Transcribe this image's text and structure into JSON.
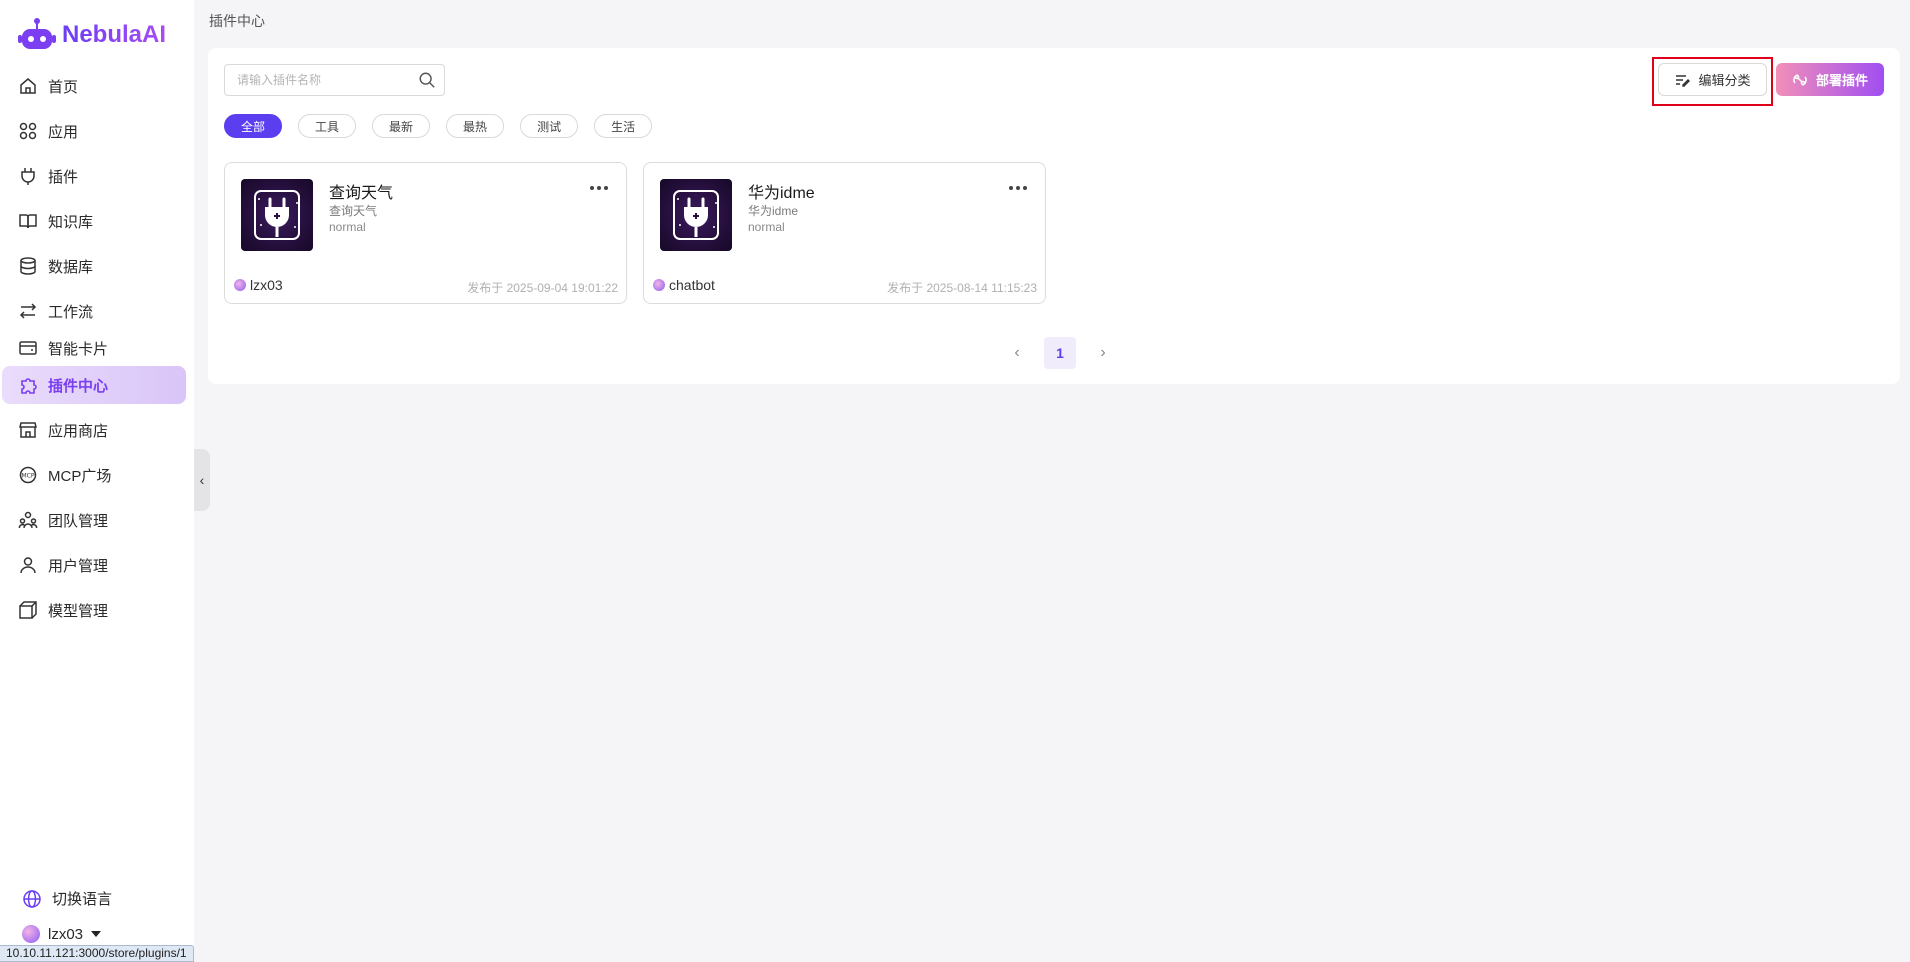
{
  "brand": {
    "name": "NebulaAI"
  },
  "sidebar": {
    "items": [
      {
        "label": "首页",
        "icon": "home-icon"
      },
      {
        "label": "应用",
        "icon": "apps-icon"
      },
      {
        "label": "插件",
        "icon": "plug-icon"
      },
      {
        "label": "知识库",
        "icon": "book-icon"
      },
      {
        "label": "数据库",
        "icon": "database-icon"
      },
      {
        "label": "工作流",
        "icon": "workflow-icon"
      },
      {
        "label": "智能卡片",
        "icon": "card-icon"
      },
      {
        "label": "插件中心",
        "icon": "puzzle-icon",
        "active": true
      },
      {
        "label": "应用商店",
        "icon": "store-icon"
      },
      {
        "label": "MCP广场",
        "icon": "mcp-icon"
      },
      {
        "label": "团队管理",
        "icon": "team-icon"
      },
      {
        "label": "用户管理",
        "icon": "user-icon"
      },
      {
        "label": "模型管理",
        "icon": "model-icon"
      }
    ],
    "language_switch": "切换语言",
    "user": "lzx03"
  },
  "status_bar_url": "10.10.11.121:3000/store/plugins/1",
  "breadcrumb": "插件中心",
  "search": {
    "placeholder": "请输入插件名称",
    "value": ""
  },
  "filters": [
    {
      "label": "全部",
      "active": true
    },
    {
      "label": "工具"
    },
    {
      "label": "最新"
    },
    {
      "label": "最热"
    },
    {
      "label": "测试"
    },
    {
      "label": "生活"
    }
  ],
  "toolbar": {
    "edit_category_label": "编辑分类",
    "deploy_label": "部署插件"
  },
  "plugins": [
    {
      "title": "查询天气",
      "description": "查询天气",
      "type": "normal",
      "author": "lzx03",
      "published": "发布于 2025-09-04 19:01:22"
    },
    {
      "title": "华为idme",
      "description": "华为idme",
      "type": "normal",
      "author": "chatbot",
      "published": "发布于 2025-08-14 11:15:23"
    }
  ],
  "pagination": {
    "current": "1"
  },
  "colors": {
    "accent": "#5b3ef0",
    "active_nav_bg": "#e2d0fa",
    "highlight_outline": "#e0001b",
    "deploy_gradient_start": "#f28fb8",
    "deploy_gradient_end": "#a04ef2"
  }
}
